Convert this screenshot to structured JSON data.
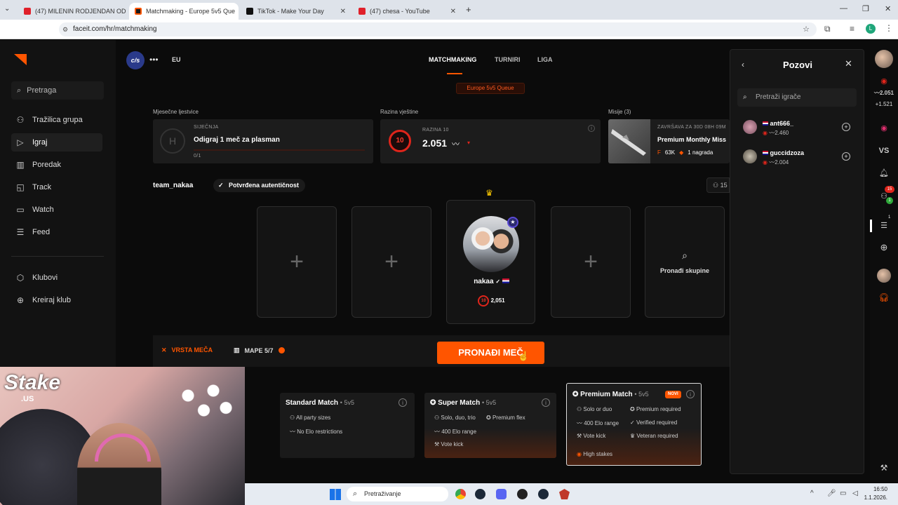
{
  "browser": {
    "tabs": [
      {
        "label": "(47) MILENIN RODJENDAN OD",
        "color": "#e0202a"
      },
      {
        "label": "Matchmaking - Europe 5v5 Que",
        "color": "#ff5500"
      },
      {
        "label": "TikTok - Make Your Day",
        "color": "#111111"
      },
      {
        "label": "(47) chesa - YouTube",
        "color": "#e0202a"
      }
    ],
    "url": "faceit.com/hr/matchmaking",
    "profile_letter": "L"
  },
  "sidebar": {
    "search_label": "Pretraga",
    "items": [
      {
        "label": "Tražilica grupa",
        "icon": "group-finder-icon"
      },
      {
        "label": "Igraj",
        "icon": "play-icon"
      },
      {
        "label": "Poredak",
        "icon": "ranking-icon"
      },
      {
        "label": "Track",
        "icon": "track-icon"
      },
      {
        "label": "Watch",
        "icon": "watch-icon"
      },
      {
        "label": "Feed",
        "icon": "feed-icon"
      },
      {
        "label": "Klubovi",
        "icon": "clubs-icon"
      },
      {
        "label": "Kreiraj klub",
        "icon": "create-club-icon"
      }
    ]
  },
  "topbar": {
    "game_badge": "c/s",
    "region": "EU",
    "nav": [
      "MATCHMAKING",
      "TURNIRI",
      "LIGA"
    ],
    "queue_label": "Europe 5v5 Queue"
  },
  "panels": {
    "leaderboard_title": "Mjesečne ljestvice",
    "leaderboard_month": "SIJEČNJA",
    "leaderboard_text": "Odigraj 1 meč za plasman",
    "leaderboard_progress": "0/1",
    "skill_title": "Razina vještine",
    "skill_level_label": "RAZINA 10",
    "skill_level": "10",
    "skill_elo": "2.051",
    "missions_title": "Misije (3)",
    "missions_timer": "ZAVRŠAVA ZA 30D 08H 09M",
    "missions_name": "Premium Monthly Miss",
    "missions_points": "63K",
    "missions_reward": "1 nagrada"
  },
  "party": {
    "team_name": "team_nakaa",
    "verified_label": "Potvrđena autentičnost",
    "party_count": "15",
    "player_name": "nakaa",
    "player_level": "10",
    "player_elo": "2,051",
    "find_party_label": "Pronađi skupine"
  },
  "actions": {
    "match_type_label": "VRSTA MEČA",
    "maps_label": "MAPE 5/7",
    "find_match_label": "PRONAĐI MEČ"
  },
  "match_types": [
    {
      "title": "Standard Match",
      "size": "5v5",
      "features": [
        "All party sizes",
        "No Elo restrictions"
      ]
    },
    {
      "title": "Super Match",
      "size": "5v5",
      "features": [
        "Solo, duo, trio",
        "Premium flex",
        "400 Elo range",
        "Vote kick"
      ]
    },
    {
      "title": "Premium Match",
      "size": "5v5",
      "badge": "NOVI",
      "features": [
        "Solo or duo",
        "Premium required",
        "400 Elo range",
        "Verified required",
        "Vote kick",
        "Veteran required",
        "High stakes"
      ]
    }
  ],
  "invite_panel": {
    "title": "Pozovi",
    "search_placeholder": "Pretraži igrače",
    "players": [
      {
        "name": "ant666_",
        "elo": "2.460"
      },
      {
        "name": "guccidzoza",
        "elo": "2.004"
      }
    ]
  },
  "right_rail": {
    "elo": "2.051",
    "elo_change": "+1.521",
    "vs_label": "VS",
    "friends_badge": "15",
    "friends_badge2": "1",
    "party_badge": "1"
  },
  "webcam": {
    "overlay_logo": "Stake",
    "overlay_sub": ".US"
  },
  "taskbar": {
    "search_label": "Pretraživanje",
    "time": "16:50",
    "date": "1.1.2026."
  },
  "colors": {
    "accent": "#ff5500",
    "background": "#0b0b0b",
    "card": "#1c1c1c"
  }
}
